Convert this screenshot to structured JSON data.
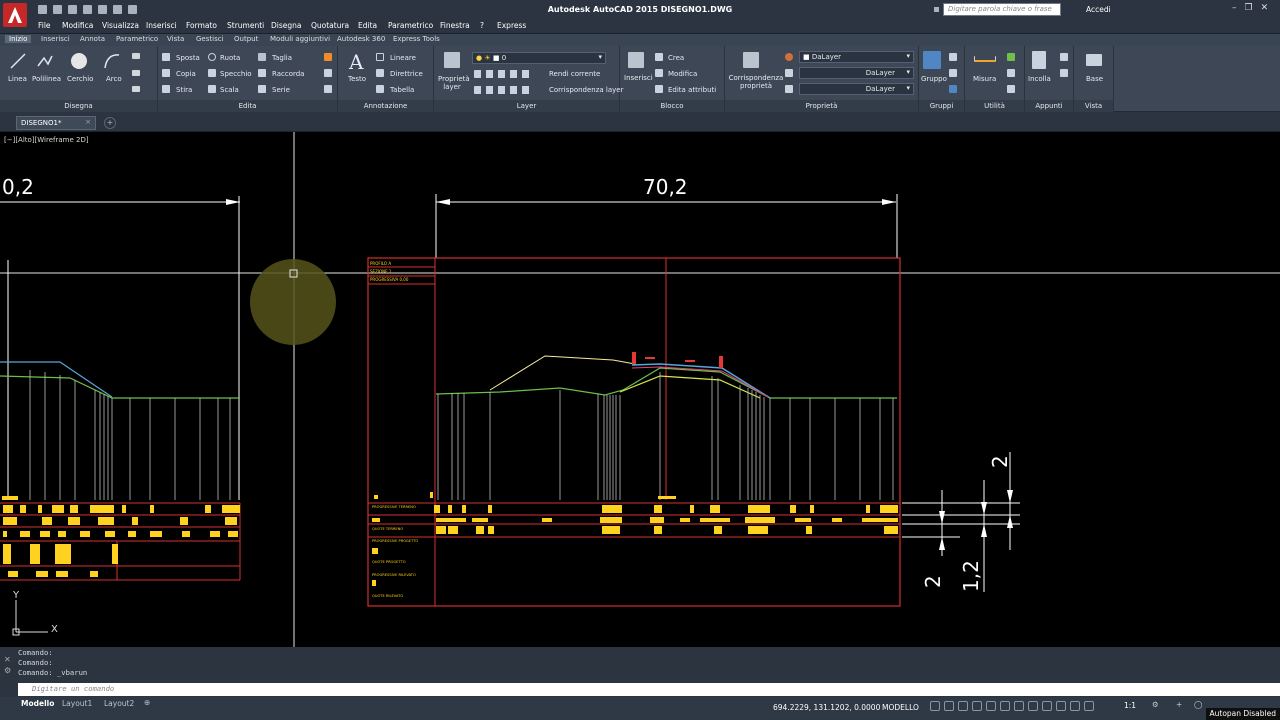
{
  "app": {
    "title": "Autodesk AutoCAD 2015   DISEGNO1.DWG",
    "search_placeholder": "Digitare parola chiave o frase",
    "login": "Accedi"
  },
  "menu": [
    "File",
    "Modifica",
    "Visualizza",
    "Inserisci",
    "Formato",
    "Strumenti",
    "Disegna",
    "Quotatura",
    "Edita",
    "Parametrico",
    "Finestra",
    "?",
    "Express"
  ],
  "ribbon_tabs": [
    "Inizio",
    "Inserisci",
    "Annota",
    "Parametrico",
    "Vista",
    "Gestisci",
    "Output",
    "Moduli aggiuntivi",
    "Autodesk 360",
    "Express Tools"
  ],
  "panels": {
    "disegna": {
      "label": "Disegna",
      "items": [
        "Linea",
        "Polilinea",
        "Cerchio",
        "Arco"
      ]
    },
    "edita": {
      "label": "Edita",
      "items": [
        "Sposta",
        "Ruota",
        "Taglia",
        "Copia",
        "Specchio",
        "Raccorda",
        "Stira",
        "Scala",
        "Serie"
      ]
    },
    "annotazione": {
      "label": "Annotazione",
      "items": [
        "Testo",
        "Lineare",
        "Direttrice",
        "Tabella"
      ]
    },
    "layer": {
      "label": "Layer",
      "items": [
        "Proprietà layer",
        "Rendi corrente",
        "Corrispondenza layer"
      ],
      "current": "0"
    },
    "blocco": {
      "label": "Blocco",
      "items": [
        "Inserisci",
        "Crea",
        "Modifica",
        "Edita attributi"
      ]
    },
    "proprieta": {
      "label": "Proprietà",
      "items": [
        "Corrispondenza proprietà"
      ],
      "color": "DaLayer",
      "linetype": "DaLayer",
      "lineweight": "DaLayer"
    },
    "gruppi": {
      "label": "Gruppi",
      "items": [
        "Gruppo"
      ]
    },
    "utilita": {
      "label": "Utilità",
      "items": [
        "Misura"
      ]
    },
    "appunti": {
      "label": "Appunti",
      "items": [
        "Incolla"
      ]
    },
    "vista": {
      "label": "Vista",
      "items": [
        "Base"
      ]
    }
  },
  "document_tab": "DISEGNO1*",
  "viewport": {
    "label": "[−][Alto][Wireframe 2D]",
    "dimensions": [
      "0,2",
      "70,2",
      "2",
      "2",
      "1,2"
    ],
    "table_rows": [
      "PROGRESSIVE TERRENO",
      "QUOTE TERRENO",
      "PROGRESSIVE PROGETTO",
      "QUOTE PROGETTO",
      "PROGRESSIVE RILEVATO",
      "QUOTE RILEVATO"
    ],
    "header_rows": [
      "PROFILO A",
      "SEZIONE 1",
      "PROGRESSIVA 0,00"
    ],
    "ucs": {
      "x": "X",
      "y": "Y"
    }
  },
  "command": {
    "history": [
      "Comando:",
      "Comando:",
      "Comando: _vbarun"
    ],
    "placeholder": "Digitare un comando"
  },
  "status": {
    "tabs": [
      "Modello",
      "Layout1",
      "Layout2"
    ],
    "coords": "694.2229, 131.1202, 0.0000",
    "mode": "MODELLO",
    "scale": "1:1",
    "autopan": "Autopan Disabled"
  }
}
